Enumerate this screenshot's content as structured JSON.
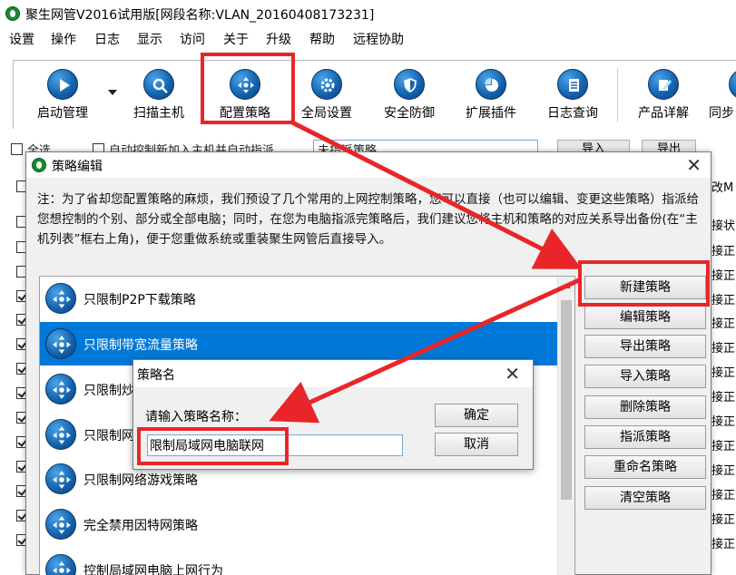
{
  "window": {
    "title": "聚生网管V2016试用版[网段名称:VLAN_20160408173231]"
  },
  "menu": [
    "设置",
    "操作",
    "日志",
    "显示",
    "访问",
    "关于",
    "升级",
    "帮助",
    "远程协助"
  ],
  "toolbar": {
    "buttons": [
      {
        "label": "启动管理",
        "icon": "play-icon"
      },
      {
        "label": "扫描主机",
        "icon": "magnifier-icon"
      },
      {
        "label": "配置策略",
        "icon": "cross-arrows-icon"
      },
      {
        "label": "全局设置",
        "icon": "gear-icon"
      },
      {
        "label": "安全防御",
        "icon": "shield-icon"
      },
      {
        "label": "扩展插件",
        "icon": "pie-icon"
      },
      {
        "label": "日志查询",
        "icon": "notebook-icon"
      },
      {
        "label": "产品详解",
        "icon": "pencil-icon"
      },
      {
        "label": "同步",
        "icon": "sync-icon"
      }
    ]
  },
  "background": {
    "select_all": "全选",
    "auto_control": "自动控制新加入主机并自动指派",
    "strategy_select": "未指派策略",
    "import_btn": "导入",
    "export_btn": "导出",
    "right_column": [
      "改M",
      "接状",
      "接正",
      "接正",
      "接正",
      "接正",
      "接正",
      "接正",
      "接正",
      "接正",
      "接正",
      "接正",
      "接正",
      "接正",
      "接正"
    ]
  },
  "dialog": {
    "title": "策略编辑",
    "note": "注：为了省却您配置策略的麻烦，我们预设了几个常用的上网控制策略，您可以直接（也可以编辑、变更这些策略）指派给您想控制的个别、部分或全部电脑；同时，在您为电脑指派完策略后，我们建议您将主机和策略的对应关系导出备份(在“主机列表”框右上角)，便于您重做系统或重装聚生网管后直接导入。",
    "strategies": [
      {
        "name": "只限制P2P下载策略",
        "selected": false
      },
      {
        "name": "只限制带宽流量策略",
        "selected": true
      },
      {
        "name": "只限制炒",
        "selected": false
      },
      {
        "name": "只限制网",
        "selected": false
      },
      {
        "name": "只限制网络游戏策略",
        "selected": false
      },
      {
        "name": "完全禁用因特网策略",
        "selected": false
      },
      {
        "name": "控制局域网电脑上网行为",
        "selected": false
      }
    ],
    "buttons": {
      "new": "新建策略",
      "edit": "编辑策略",
      "export": "导出策略",
      "import": "导入策略",
      "delete": "删除策略",
      "assign": "指派策略",
      "rename": "重命名策略",
      "clear": "清空策略"
    }
  },
  "name_dialog": {
    "title": "策略名",
    "prompt": "请输入策略名称：",
    "value": "限制局域网电脑联网",
    "ok": "确定",
    "cancel": "取消"
  },
  "annotation_color": "#e8262a"
}
